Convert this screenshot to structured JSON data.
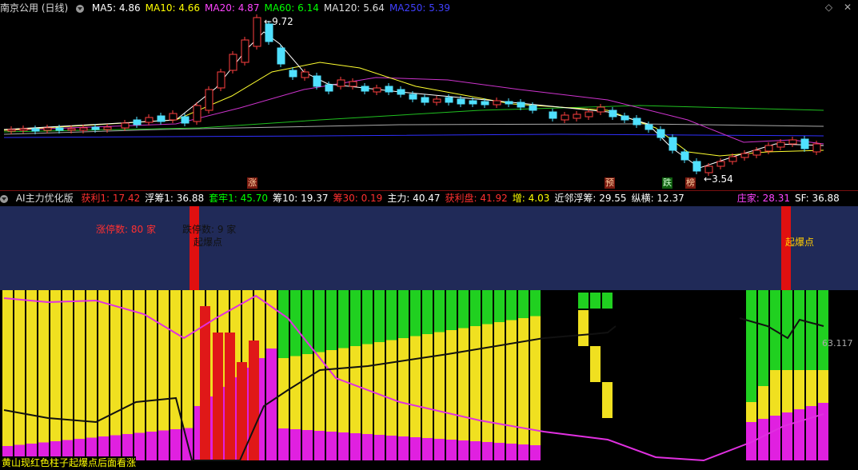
{
  "header": {
    "title": "南京公用 (日线)",
    "ma": [
      {
        "label": "MA5: 4.86",
        "color": "#ffffff"
      },
      {
        "label": "MA10: 4.66",
        "color": "#ffff00"
      },
      {
        "label": "MA20: 4.87",
        "color": "#ff44ff"
      },
      {
        "label": "MA60: 6.14",
        "color": "#00ff00"
      },
      {
        "label": "MA120: 5.64",
        "color": "#dddddd"
      },
      {
        "label": "MA250: 5.39",
        "color": "#4040ff"
      }
    ]
  },
  "price_chart": {
    "high_label": "9.72",
    "low_label": "3.54",
    "tags": {
      "zhang": "涨",
      "yu": "预",
      "die": "跌",
      "bang": "榜"
    }
  },
  "indicator": {
    "name": "AI主力优化版",
    "values": [
      {
        "label": "获利1: 17.42",
        "color": "#ff3030"
      },
      {
        "label": "浮筹1: 36.88",
        "color": "#ffffff"
      },
      {
        "label": "套牢1: 45.70",
        "color": "#00ff00"
      },
      {
        "label": "筹10: 19.37",
        "color": "#ffffff"
      },
      {
        "label": "筹30: 0.19",
        "color": "#ff3030"
      },
      {
        "label": "主力: 40.47",
        "color": "#ffffff"
      },
      {
        "label": "获利盘: 41.92",
        "color": "#ff3030"
      },
      {
        "label": "增: 4.03",
        "color": "#ffff00"
      },
      {
        "label": "近邻浮筹: 29.55",
        "color": "#ffffff"
      },
      {
        "label": "纵横: 12.37",
        "color": "#ffffff"
      },
      {
        "label": "庄家: 28.31",
        "color": "#ff44ff"
      },
      {
        "label": "SF: 36.88",
        "color": "#ffffff"
      }
    ],
    "zt_count": "涨停数: 80 家",
    "dt_count": "跌停数: 9 家",
    "burst_label_1": "起爆点",
    "burst_label_2": "起爆点",
    "right_value": "63.117",
    "bottom_note": "黄山现红色柱子起爆点后面看涨"
  }
}
